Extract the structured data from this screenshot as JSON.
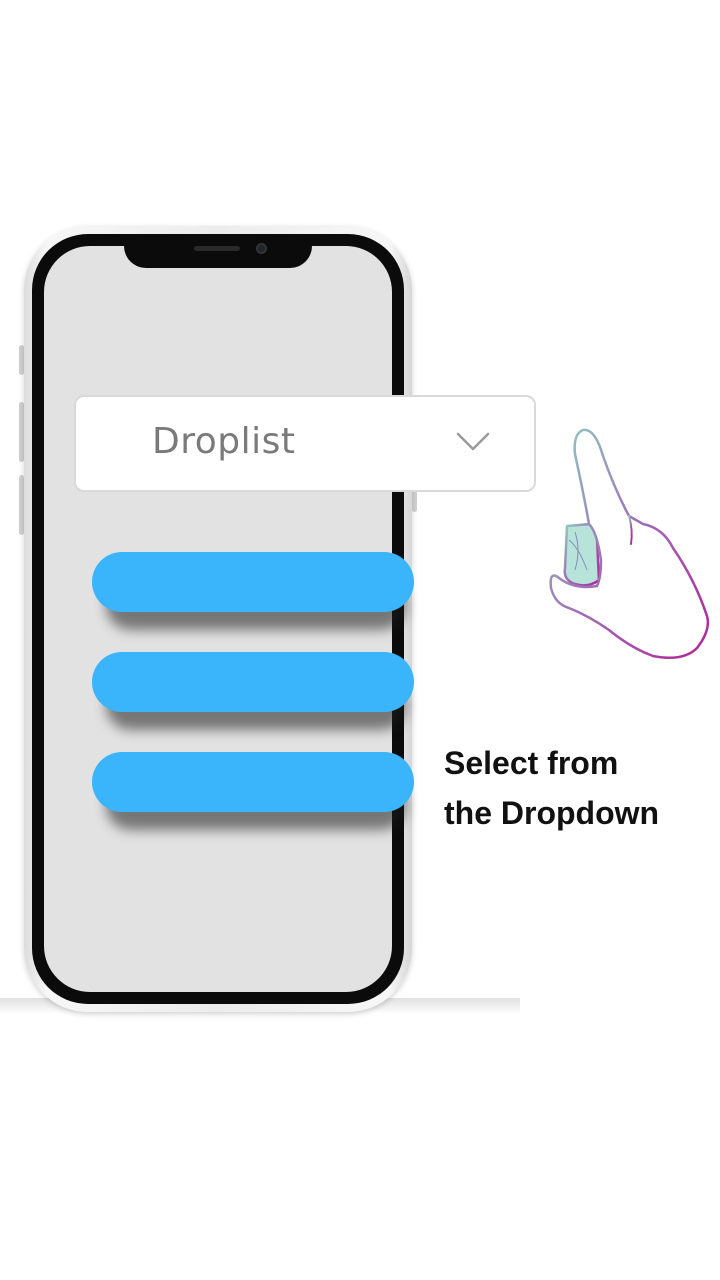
{
  "droplist": {
    "label": "Droplist",
    "icon": "chevron-down-icon"
  },
  "menu": {
    "option_color": "#3ab4fb",
    "option_count": 3
  },
  "caption": {
    "line1": "Select from",
    "line2": "the Dropdown"
  },
  "hand": {
    "icon": "pointing-hand-icon"
  }
}
